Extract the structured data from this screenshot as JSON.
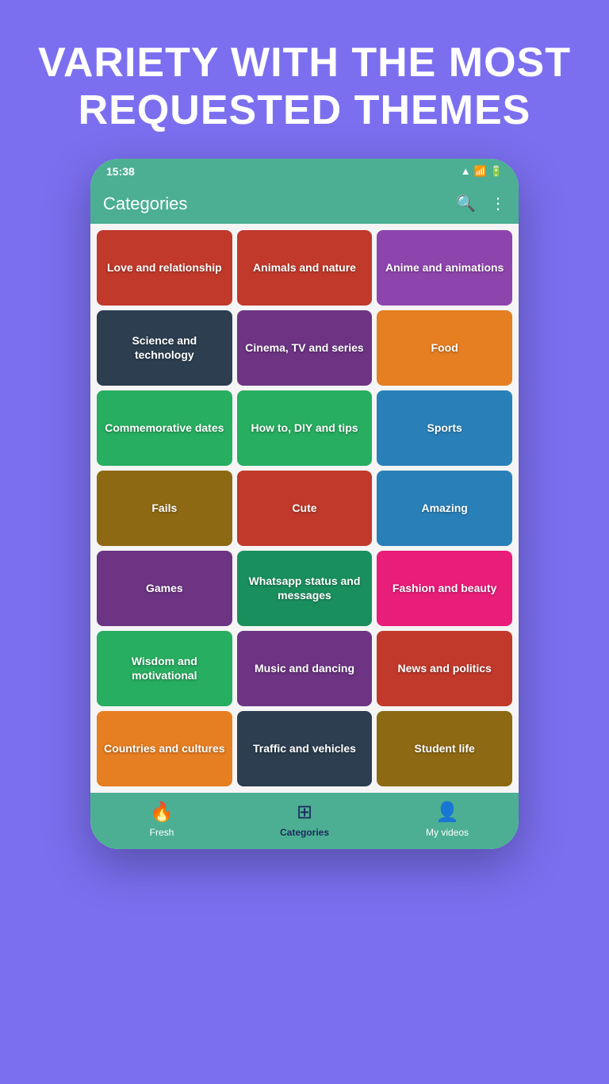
{
  "hero": {
    "title": "VARIETY WITH THE MOST REQUESTED THEMES"
  },
  "statusBar": {
    "time": "15:38"
  },
  "appBar": {
    "title": "Categories"
  },
  "categories": [
    {
      "id": "love",
      "label": "Love and relationship",
      "colorClass": "cat-love"
    },
    {
      "id": "animals",
      "label": "Animals and nature",
      "colorClass": "cat-animals"
    },
    {
      "id": "anime",
      "label": "Anime and animations",
      "colorClass": "cat-anime"
    },
    {
      "id": "science",
      "label": "Science and technology",
      "colorClass": "cat-science"
    },
    {
      "id": "cinema",
      "label": "Cinema, TV and series",
      "colorClass": "cat-cinema"
    },
    {
      "id": "food",
      "label": "Food",
      "colorClass": "cat-food"
    },
    {
      "id": "commemorative",
      "label": "Commemorative dates",
      "colorClass": "cat-commemorative"
    },
    {
      "id": "howto",
      "label": "How to, DIY and tips",
      "colorClass": "cat-howto"
    },
    {
      "id": "sports",
      "label": "Sports",
      "colorClass": "cat-sports"
    },
    {
      "id": "fails",
      "label": "Fails",
      "colorClass": "cat-fails"
    },
    {
      "id": "cute",
      "label": "Cute",
      "colorClass": "cat-cute"
    },
    {
      "id": "amazing",
      "label": "Amazing",
      "colorClass": "cat-amazing"
    },
    {
      "id": "games",
      "label": "Games",
      "colorClass": "cat-games"
    },
    {
      "id": "whatsapp",
      "label": "Whatsapp status and messages",
      "colorClass": "cat-whatsapp"
    },
    {
      "id": "fashion",
      "label": "Fashion and beauty",
      "colorClass": "cat-fashion"
    },
    {
      "id": "wisdom",
      "label": "Wisdom and motivational",
      "colorClass": "cat-wisdom"
    },
    {
      "id": "music",
      "label": "Music and dancing",
      "colorClass": "cat-music"
    },
    {
      "id": "news",
      "label": "News and politics",
      "colorClass": "cat-news"
    },
    {
      "id": "countries",
      "label": "Countries and cultures",
      "colorClass": "cat-countries"
    },
    {
      "id": "traffic",
      "label": "Traffic and vehicles",
      "colorClass": "cat-traffic"
    },
    {
      "id": "student",
      "label": "Student life",
      "colorClass": "cat-student"
    }
  ],
  "bottomNav": {
    "items": [
      {
        "id": "fresh",
        "label": "Fresh",
        "icon": "🔥",
        "active": false
      },
      {
        "id": "categories",
        "label": "Categories",
        "icon": "⊞",
        "active": true
      },
      {
        "id": "myvideos",
        "label": "My videos",
        "icon": "👤",
        "active": false
      }
    ]
  }
}
